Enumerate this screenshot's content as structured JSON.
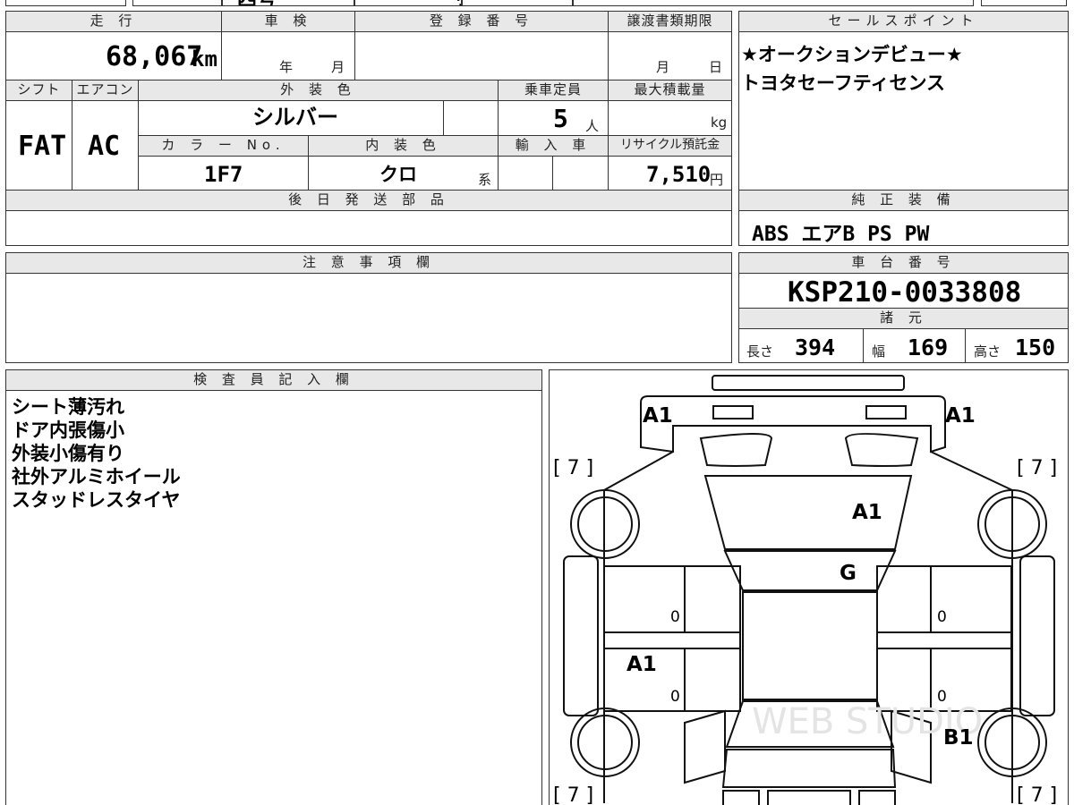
{
  "top_strip": {
    "partial_text": "四号",
    "partial_text2": "り"
  },
  "vehicle": {
    "mileage_label": "走 行",
    "mileage_value": "68,067",
    "mileage_unit": "km",
    "inspection_label": "車 検",
    "inspection_year_unit": "年",
    "inspection_month_unit": "月",
    "registration_label": "登 録 番 号",
    "registration_value": "",
    "transfer_label": "譲渡書類期限",
    "transfer_month_unit": "月",
    "transfer_day_unit": "日",
    "shift_label": "シフト",
    "shift_value": "FAT",
    "ac_label": "エアコン",
    "ac_value": "AC",
    "exterior_label": "外 装 色",
    "exterior_value": "シルバー",
    "capacity_label": "乗車定員",
    "capacity_value": "5",
    "capacity_unit": "人",
    "maxload_label": "最大積載量",
    "maxload_unit": "kg",
    "color_no_label": "カ ラ ー No.",
    "color_no_value": "1F7",
    "interior_label": "内 装 色",
    "interior_value": "クロ",
    "interior_unit": "系",
    "import_label": "輸 入 車",
    "recycle_label": "リサイクル預託金",
    "recycle_value": "7,510",
    "recycle_unit": "円",
    "later_parts_label": "後 日 発 送 部 品"
  },
  "sales_points": {
    "label": "セールスポイント",
    "lines": [
      "★オークションデビュー★",
      "トヨタセーフティセンス"
    ]
  },
  "equipment": {
    "label": "純 正 装 備",
    "value": "ABS エアB PS PW"
  },
  "notes": {
    "label": "注 意 事 項 欄"
  },
  "chassis": {
    "label": "車 台 番 号",
    "value": "KSP210-0033808",
    "spec_label": "諸 元",
    "length_label": "長さ",
    "length_value": "394",
    "width_label": "幅",
    "width_value": "169",
    "height_label": "高さ",
    "height_value": "150"
  },
  "inspector": {
    "label": "検 査 員 記 入 欄",
    "lines": [
      "シート薄汚れ",
      "ドア内張傷小",
      "外装小傷有り",
      "社外アルミホイール",
      "スタッドレスタイヤ"
    ]
  },
  "diagram": {
    "marks": {
      "front_left": "A1",
      "front_right": "A1",
      "hood": "A1",
      "windshield": "G",
      "left_door": "A1",
      "right_rear": "B1",
      "zero_1": "0",
      "zero_2": "0",
      "zero_3": "0",
      "zero_4": "0"
    },
    "tire_tl": "[ 7 ]",
    "tire_tr": "[ 7 ]",
    "tire_bl": "[ 7 ]",
    "tire_br": "[ 7 ]",
    "watermark": "WEB STUDIO"
  }
}
